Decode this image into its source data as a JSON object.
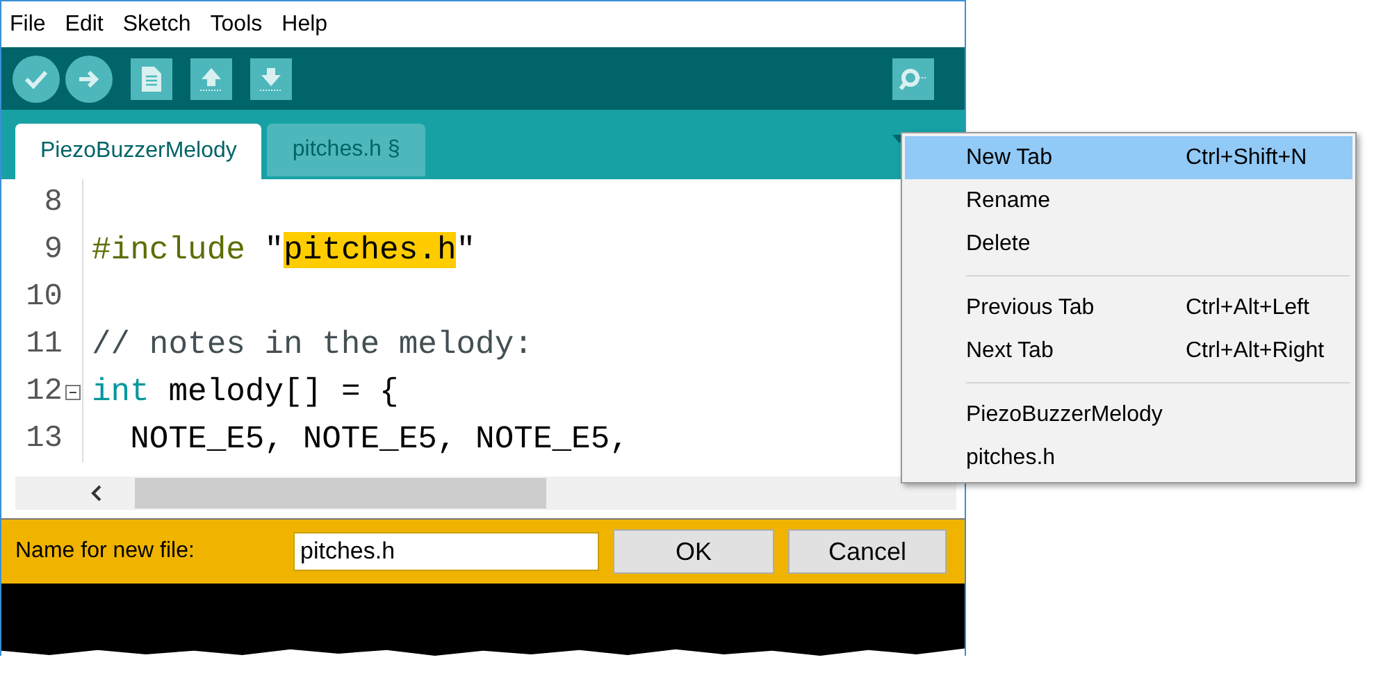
{
  "menu_bar": [
    "File",
    "Edit",
    "Sketch",
    "Tools",
    "Help"
  ],
  "tabs": [
    {
      "label": "PiezoBuzzerMelody",
      "selected": true
    },
    {
      "label": "pitches.h §",
      "selected": false
    }
  ],
  "editor": {
    "lines": [
      {
        "number": "8",
        "fold": false
      },
      {
        "number": "9",
        "fold": false,
        "tokens": [
          {
            "text": "#include",
            "kind": "directive"
          },
          {
            "text": " \"",
            "kind": "plain"
          },
          {
            "text": "pitches.h",
            "kind": "highlight"
          },
          {
            "text": "\"",
            "kind": "plain"
          }
        ]
      },
      {
        "number": "10",
        "fold": false
      },
      {
        "number": "11",
        "fold": false,
        "tokens": [
          {
            "text": "// notes in the melody:",
            "kind": "comment"
          }
        ]
      },
      {
        "number": "12",
        "fold": true,
        "tokens": [
          {
            "text": "int",
            "kind": "type"
          },
          {
            "text": " melody[] = {",
            "kind": "plain"
          }
        ]
      },
      {
        "number": "13",
        "fold": false,
        "tokens": [
          {
            "text": "  NOTE_E5, NOTE_E5, NOTE_E5,",
            "kind": "plain"
          }
        ]
      }
    ]
  },
  "dialog": {
    "label": "Name for new file:",
    "value": "pitches.h",
    "buttons": [
      "OK",
      "Cancel"
    ]
  },
  "context_menu": {
    "groups": [
      [
        {
          "label": "New Tab",
          "shortcut": "Ctrl+Shift+N",
          "selected": true
        },
        {
          "label": "Rename",
          "selected": false
        },
        {
          "label": "Delete",
          "selected": false
        }
      ],
      [
        {
          "label": "Previous Tab",
          "shortcut": "Ctrl+Alt+Left",
          "selected": false
        },
        {
          "label": "Next Tab",
          "shortcut": "Ctrl+Alt+Right",
          "selected": false
        }
      ],
      [
        {
          "label": "PiezoBuzzerMelody",
          "selected": false
        },
        {
          "label": "pitches.h",
          "selected": false
        }
      ]
    ]
  }
}
